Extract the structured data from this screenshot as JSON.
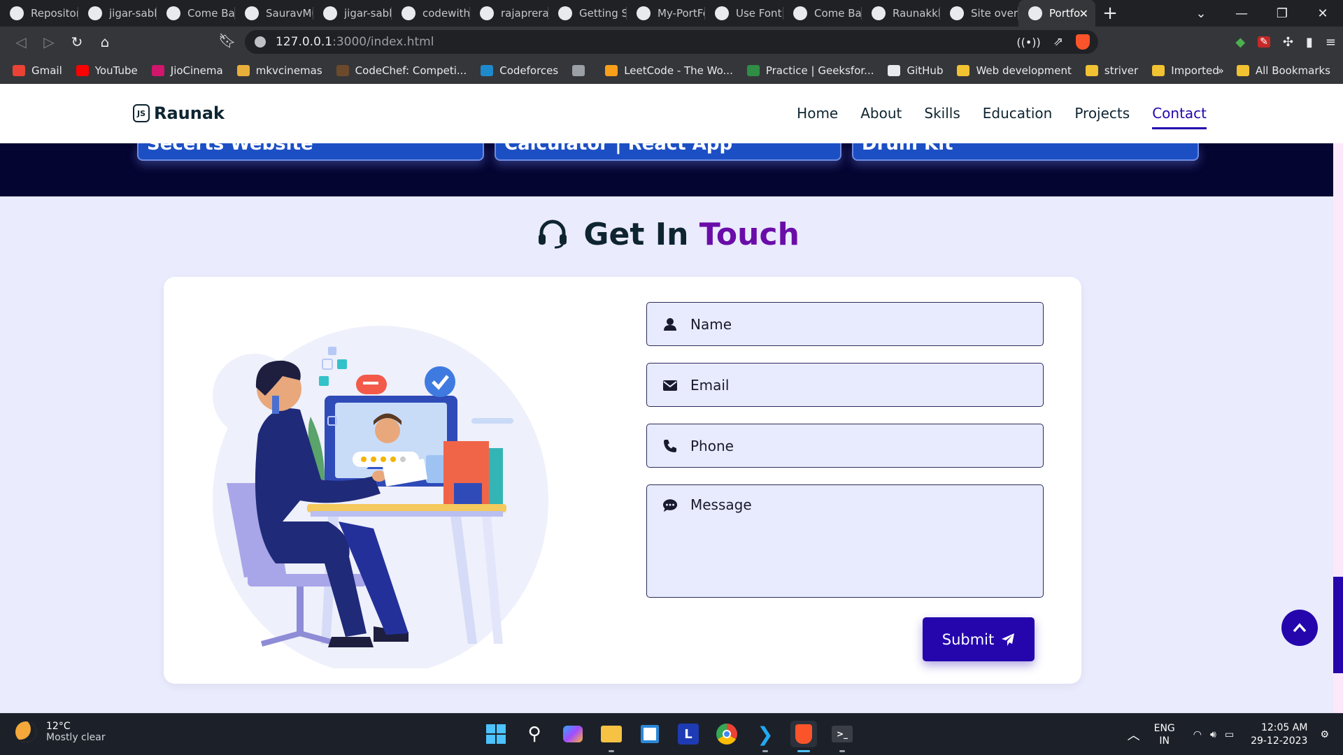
{
  "browser": {
    "tabs": [
      {
        "label": "Repository",
        "icon": "github-icon"
      },
      {
        "label": "jigar-sable",
        "icon": "github-icon"
      },
      {
        "label": "Come Back",
        "icon": "praying-hands-icon"
      },
      {
        "label": "SauravMu",
        "icon": "github-icon"
      },
      {
        "label": "jigar-sable",
        "icon": "github-icon"
      },
      {
        "label": "codewiths",
        "icon": "github-icon"
      },
      {
        "label": "rajaprerak",
        "icon": "github-icon"
      },
      {
        "label": "Getting St",
        "icon": "doc-icon"
      },
      {
        "label": "My-PortFo",
        "icon": "globe-icon"
      },
      {
        "label": "Use Font A",
        "icon": "flag-icon"
      },
      {
        "label": "Come Back",
        "icon": "avatar-icon"
      },
      {
        "label": "Raunakkk",
        "icon": "github-icon"
      },
      {
        "label": "Site overv",
        "icon": "netlify-icon"
      },
      {
        "label": "Portfo",
        "icon": "globe-icon"
      }
    ],
    "url_host": "127.0.0.1",
    "url_path": ":3000/index.html",
    "bookmarks": [
      {
        "label": "Gmail",
        "color": "#ea4335"
      },
      {
        "label": "YouTube",
        "color": "#ff0000"
      },
      {
        "label": "JioCinema",
        "color": "#d1166b"
      },
      {
        "label": "mkvcinemas",
        "color": "#e8b03b"
      },
      {
        "label": "CodeChef: Competi...",
        "color": "#6b4a2b"
      },
      {
        "label": "Codeforces",
        "color": "#1f8acb"
      },
      {
        "label": "",
        "color": "#9aa0a6"
      },
      {
        "label": "LeetCode - The Wo...",
        "color": "#f89f1b"
      },
      {
        "label": "Practice | Geeksfor...",
        "color": "#2f8d46"
      },
      {
        "label": "GitHub",
        "color": "#e8eaed"
      },
      {
        "label": "Web development",
        "color": "#f1c232"
      },
      {
        "label": "striver",
        "color": "#f1c232"
      },
      {
        "label": "Imported",
        "color": "#f1c232"
      }
    ],
    "bookmarks_overflow": "»",
    "all_bookmarks": "All Bookmarks"
  },
  "site": {
    "brand": "Raunak",
    "brand_logo": "JS",
    "nav": [
      "Home",
      "About",
      "Skills",
      "Education",
      "Projects",
      "Contact"
    ],
    "active_nav": "Contact",
    "project_cards": [
      "Secerts Website",
      "Calculator | React App",
      "Drum Kit"
    ],
    "contact": {
      "title_main": "Get In",
      "title_accent": "Touch",
      "name_placeholder": "Name",
      "email_placeholder": "Email",
      "phone_placeholder": "Phone",
      "message_placeholder": "Message",
      "submit_label": "Submit"
    },
    "accent_color": "#2506ad",
    "title_accent_color": "#6a0da8"
  },
  "taskbar": {
    "temperature": "12°C",
    "weather": "Mostly clear",
    "lang_top": "ENG",
    "lang_bottom": "IN",
    "time": "12:05 AM",
    "date": "29-12-2023"
  }
}
